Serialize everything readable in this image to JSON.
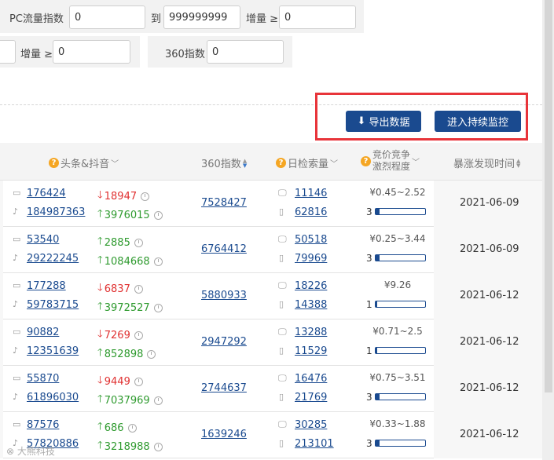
{
  "filters": {
    "pc_label": "PC流量指数",
    "pc_min": "0",
    "to_label": "到",
    "pc_max": "999999999",
    "pc_incr_label": "增量 ≥",
    "pc_incr_value": "0",
    "row2_incr_label": "增量 ≥",
    "row2_incr_value": "0",
    "s360_label": "360指数",
    "s360_value": "0"
  },
  "buttons": {
    "export": "导出数据",
    "monitor": "进入持续监控"
  },
  "table": {
    "headers": {
      "toutiao": "头条&抖音",
      "s360": "360指数",
      "daily": "日检索量",
      "bid_line1": "竞价竞争",
      "bid_line2": "激烈程度",
      "date": "暴涨发现时间"
    },
    "rows": [
      {
        "toutiao": "176424",
        "toutiao_delta": "18947",
        "toutiao_dir": "down",
        "douyin": "184987363",
        "douyin_delta": "3976015",
        "douyin_dir": "up",
        "s360": "7528427",
        "daily_pc": "11146",
        "daily_mobile": "62816",
        "price": "¥0.45~2.52",
        "level": "3",
        "date": "2021-06-09"
      },
      {
        "toutiao": "53540",
        "toutiao_delta": "2885",
        "toutiao_dir": "up",
        "douyin": "29222245",
        "douyin_delta": "1084668",
        "douyin_dir": "up",
        "s360": "6764412",
        "daily_pc": "50518",
        "daily_mobile": "79969",
        "price": "¥0.25~3.44",
        "level": "3",
        "date": "2021-06-09"
      },
      {
        "toutiao": "177288",
        "toutiao_delta": "6837",
        "toutiao_dir": "down",
        "douyin": "59783715",
        "douyin_delta": "3972527",
        "douyin_dir": "up",
        "s360": "5880933",
        "daily_pc": "18226",
        "daily_mobile": "14388",
        "price": "¥9.26",
        "level": "1",
        "date": "2021-06-12"
      },
      {
        "toutiao": "90882",
        "toutiao_delta": "7269",
        "toutiao_dir": "down",
        "douyin": "12351639",
        "douyin_delta": "852898",
        "douyin_dir": "up",
        "s360": "2947292",
        "daily_pc": "13288",
        "daily_mobile": "11529",
        "price": "¥0.71~2.5",
        "level": "1",
        "date": "2021-06-12"
      },
      {
        "toutiao": "55870",
        "toutiao_delta": "9449",
        "toutiao_dir": "down",
        "douyin": "61896030",
        "douyin_delta": "7037969",
        "douyin_dir": "up",
        "s360": "2744637",
        "daily_pc": "16476",
        "daily_mobile": "21769",
        "price": "¥0.75~3.51",
        "level": "3",
        "date": "2021-06-12"
      },
      {
        "toutiao": "87576",
        "toutiao_delta": "686",
        "toutiao_dir": "up",
        "douyin": "57820886",
        "douyin_delta": "3218988",
        "douyin_dir": "up",
        "s360": "1639246",
        "daily_pc": "30285",
        "daily_mobile": "213101",
        "price": "¥0.33~1.88",
        "level": "3",
        "date": "2021-06-12"
      }
    ]
  },
  "colors": {
    "accent": "#1a4a8f",
    "up": "#2e9a2e",
    "down": "#e03030",
    "highlight": "#e8343a",
    "help_icon": "#f5a623"
  }
}
